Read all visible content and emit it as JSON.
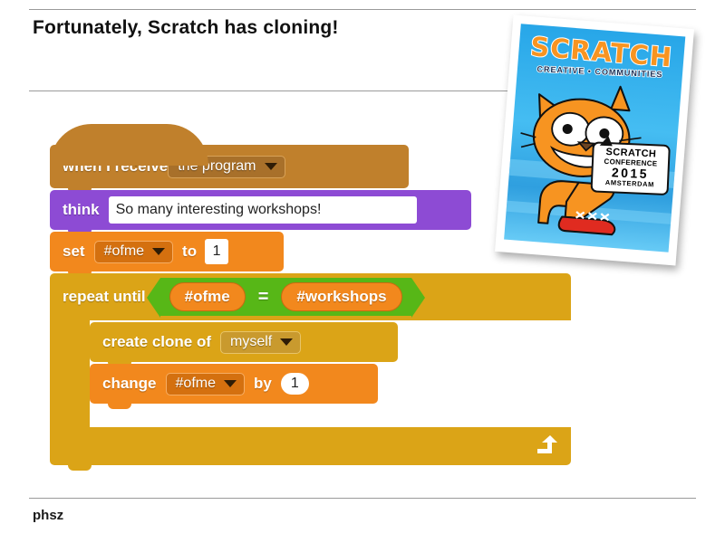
{
  "slide": {
    "title": "Fortunately, Scratch has cloning!",
    "footer": "phsz"
  },
  "script": {
    "blocks": [
      {
        "id": "when-i-receive",
        "kind": "hat",
        "category": "events",
        "color": "#c0802c",
        "label": "when I receive",
        "dropdown_value": "the program"
      },
      {
        "id": "think",
        "kind": "stack",
        "category": "looks",
        "color": "#8d4bd4",
        "label": "think",
        "text_value": "So many interesting workshops!"
      },
      {
        "id": "set-variable",
        "kind": "stack",
        "category": "variables",
        "color": "#f2881d",
        "label": "set",
        "dropdown_value": "#ofme",
        "label2": "to",
        "number_value": "1"
      },
      {
        "id": "repeat-until",
        "kind": "c-block",
        "category": "control",
        "color": "#dba417",
        "label": "repeat until",
        "condition": {
          "operator": "=",
          "color": "#57b717",
          "left": "#ofme",
          "right": "#workshops"
        }
      },
      {
        "id": "create-clone-of",
        "kind": "stack",
        "category": "control",
        "color": "#dba417",
        "label": "create clone of",
        "dropdown_value": "myself"
      },
      {
        "id": "change-variable",
        "kind": "stack",
        "category": "variables",
        "color": "#f2881d",
        "label": "change",
        "dropdown_value": "#ofme",
        "label2": "by",
        "number_value": "1"
      }
    ]
  },
  "poster": {
    "title": "SCRATCH",
    "subtitle": "CREATIVE • COMMUNITIES",
    "bubble": {
      "line1": "SCRATCH",
      "line2": "CONFERENCE",
      "line3": "2015",
      "line4": "AMSTERDAM"
    }
  }
}
